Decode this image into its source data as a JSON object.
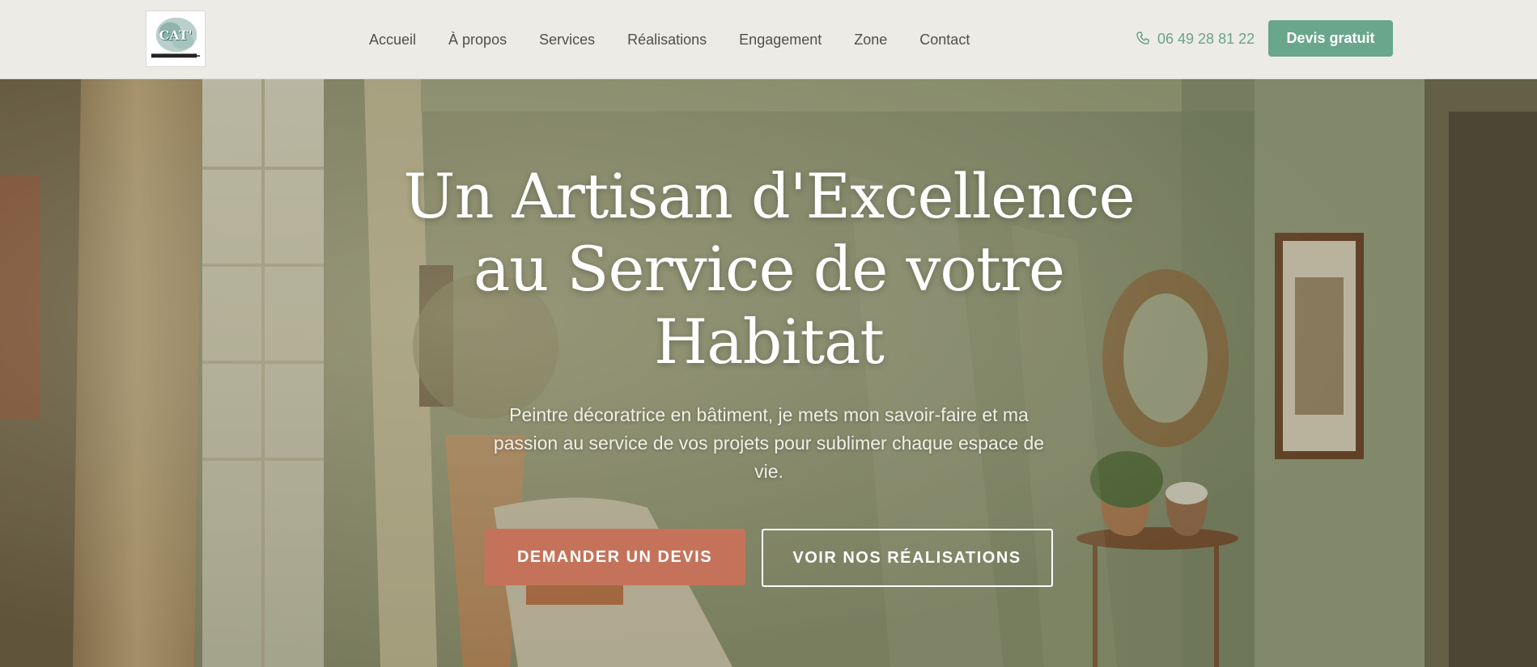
{
  "header": {
    "logo_text": "CAT'",
    "nav": [
      {
        "label": "Accueil"
      },
      {
        "label": "À propos"
      },
      {
        "label": "Services"
      },
      {
        "label": "Réalisations"
      },
      {
        "label": "Engagement"
      },
      {
        "label": "Zone"
      },
      {
        "label": "Contact"
      }
    ],
    "phone": "06 49 28 81 22",
    "phone_icon": "phone-icon",
    "cta_label": "Devis gratuit"
  },
  "hero": {
    "title_line1": "Un Artisan d'Excellence",
    "title_line2": "au Service de votre",
    "title_line3": "Habitat",
    "subtitle": "Peintre décoratrice en bâtiment, je mets mon savoir-faire et ma passion au service de vos projets pour sublimer chaque espace de vie.",
    "primary_button": "DEMANDER UN DEVIS",
    "secondary_button": "VOIR NOS RÉALISATIONS"
  },
  "colors": {
    "accent_green": "#6aa68c",
    "accent_terracotta": "#c4735a",
    "header_bg": "#edebe6"
  }
}
